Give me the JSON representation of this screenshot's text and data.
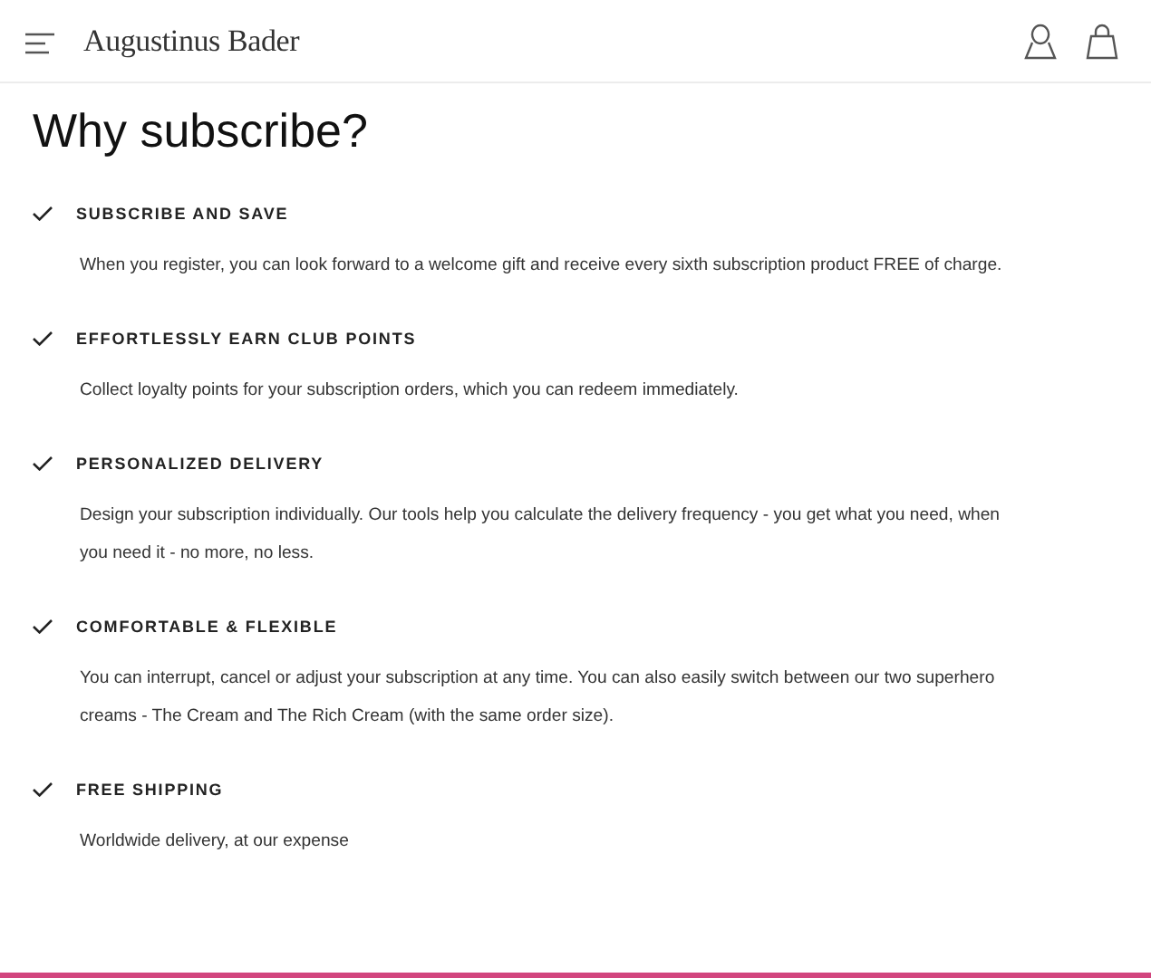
{
  "header": {
    "brand": "Augustinus Bader"
  },
  "title": "Why subscribe?",
  "benefits": [
    {
      "heading": "SUBSCRIBE AND SAVE",
      "text": "When you register, you can look forward to a welcome gift and receive every sixth subscription product FREE of charge."
    },
    {
      "heading": "EFFORTLESSLY EARN CLUB POINTS",
      "text": "Collect loyalty points for your subscription orders, which you can redeem immediately."
    },
    {
      "heading": "PERSONALIZED DELIVERY",
      "text": "Design your subscription individually. Our tools help you calculate the delivery frequency - you get what you need, when you need it - no more, no less."
    },
    {
      "heading": "COMFORTABLE & FLEXIBLE",
      "text": "You can interrupt, cancel or adjust your subscription at any time. You can also easily switch between our two superhero creams - The Cream and The Rich Cream (with the same order size)."
    },
    {
      "heading": "FREE SHIPPING",
      "text": "Worldwide delivery, at our expense"
    }
  ]
}
